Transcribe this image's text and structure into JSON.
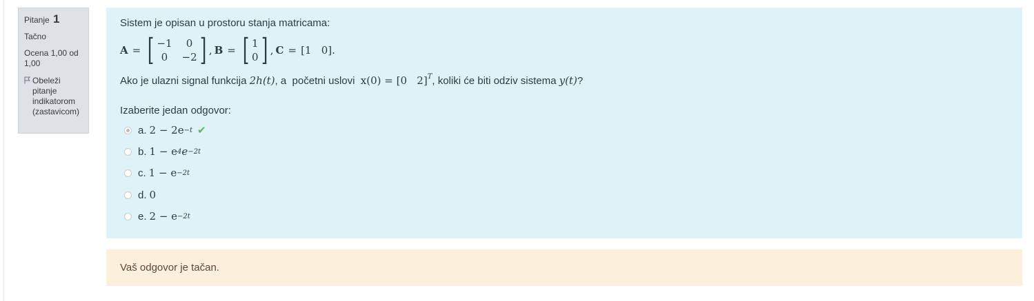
{
  "info": {
    "question_label": "Pitanje",
    "question_number": "1",
    "state": "Tačno",
    "grade": "Ocena 1,00 od 1,00",
    "flag_label": "Obeleži pitanje indikatorom (zastavicom)"
  },
  "question": {
    "intro": "Sistem je opisan u prostoru stanja matricama:",
    "A": {
      "label": "A",
      "rows": [
        [
          "−1",
          "0"
        ],
        [
          "0",
          "−2"
        ]
      ]
    },
    "B": {
      "label": "B",
      "rows": [
        [
          "1"
        ],
        [
          "0"
        ]
      ]
    },
    "C": {
      "label": "C",
      "value": "[1   0]"
    },
    "text_before_input": "Ako je ulazni signal funkcija ",
    "input": "2h(t)",
    "text_middle": ", a  početni uslovi  ",
    "initial_condition": "x(0) = [0   2]",
    "transpose": "T",
    "text_end": ", koliki će biti odziv sistema ",
    "output": "y(t)",
    "question_mark": "?",
    "prompt": "Izaberite jedan odgovor:"
  },
  "answers": [
    {
      "letter": "a.",
      "expr": "2 − 2e",
      "sup": "−t",
      "selected": true,
      "correct": true
    },
    {
      "letter": "b.",
      "expr": "1 − e",
      "sup1": "4",
      "expr2": "e",
      "sup": "−2t",
      "selected": false
    },
    {
      "letter": "c.",
      "expr": "1 − e",
      "sup": "−2t",
      "selected": false
    },
    {
      "letter": "d.",
      "expr": "0",
      "sup": "",
      "selected": false
    },
    {
      "letter": "e.",
      "expr": "2 − e",
      "sup": "−2t",
      "selected": false
    }
  ],
  "feedback": "Vaš odgovor je tačan.",
  "colors": {
    "info_bg": "#dee2e6",
    "formulation_bg": "#def2f8",
    "feedback_bg": "#fcefdc",
    "correct_check": "#5cb85c"
  }
}
